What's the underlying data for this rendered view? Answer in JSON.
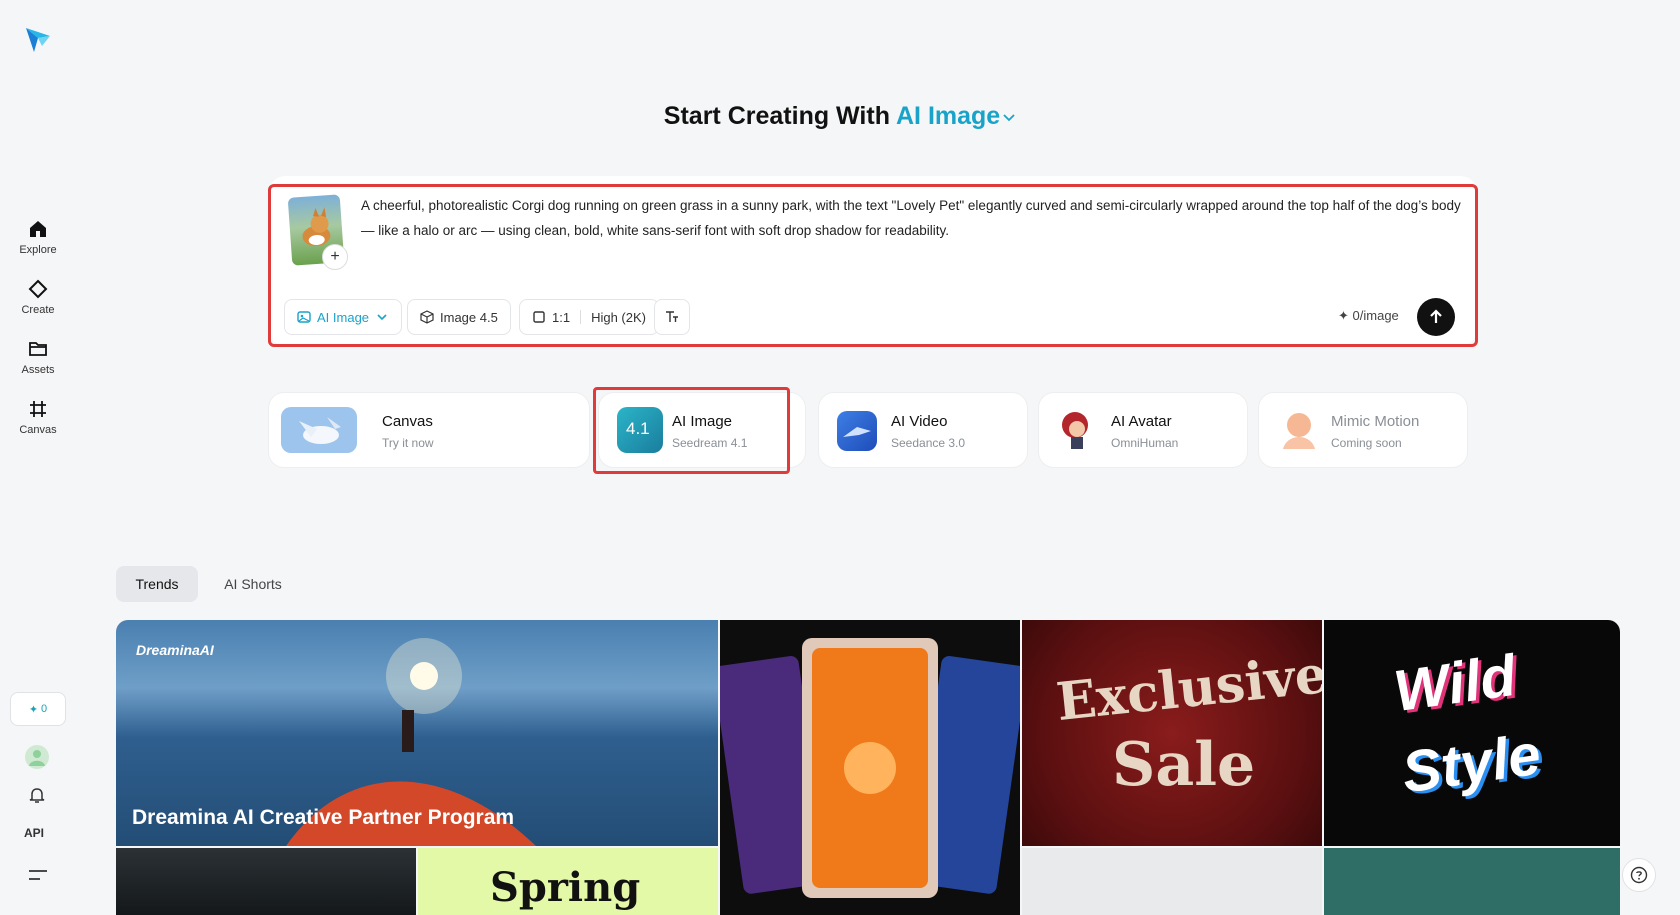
{
  "sidebar": {
    "items": [
      {
        "label": "Explore",
        "icon": "home-icon"
      },
      {
        "label": "Create",
        "icon": "diamond-icon"
      },
      {
        "label": "Assets",
        "icon": "folder-icon"
      },
      {
        "label": "Canvas",
        "icon": "crop-icon"
      }
    ],
    "credits": "0",
    "api_label": "API"
  },
  "heading": {
    "prefix": "Start Creating With",
    "mode": "AI Image"
  },
  "prompt": {
    "text": "A cheerful, photorealistic Corgi dog running on green grass in a sunny park, with the text \"Lovely Pet\" elegantly curved and semi-circularly wrapped around the top half of the dog’s body — like a halo or arc — using clean, bold, white sans-serif font with soft drop shadow for readability."
  },
  "toolbar": {
    "mode_label": "AI Image",
    "model_label": "Image 4.5",
    "ratio_label": "1:1",
    "quality_label": "High (2K)",
    "credits_label": "0/image"
  },
  "cards": [
    {
      "title": "Canvas",
      "subtitle": "Try it now"
    },
    {
      "title": "AI Image",
      "subtitle": "Seedream 4.1",
      "icon_text": "4.1"
    },
    {
      "title": "AI Video",
      "subtitle": "Seedance 3.0"
    },
    {
      "title": "AI Avatar",
      "subtitle": "OmniHuman"
    },
    {
      "title": "Mimic Motion",
      "subtitle": "Coming soon"
    }
  ],
  "tabs": [
    "Trends",
    "AI Shorts"
  ],
  "gallery": {
    "banner_logo": "DreaminaAI",
    "banner_title": "Dreamina AI Creative Partner Program",
    "exclusive_text_1": "Exclusive",
    "exclusive_text_2": "Sale",
    "wild_text_1": "Wild",
    "wild_text_2": "Style",
    "spring_text": "Spring"
  },
  "colors": {
    "accent": "#1aa3c8",
    "highlight_border": "#e03b3b",
    "background": "#f5f6f7"
  }
}
